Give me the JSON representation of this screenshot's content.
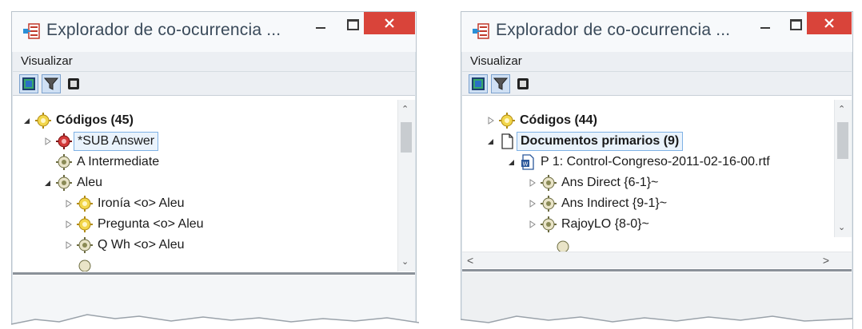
{
  "windows": [
    {
      "title": "Explorador de co-ocurrencia ...",
      "menu": [
        "Visualizar"
      ],
      "tree": [
        {
          "label": "Códigos (45)",
          "bold": true,
          "expander": "expanded",
          "icon": "code-family-icon",
          "indent": 0
        },
        {
          "label": "*SUB Answer",
          "selected": true,
          "expander": "collapsed",
          "icon": "code-red-icon",
          "indent": 1
        },
        {
          "label": "A Intermediate",
          "expander": "none",
          "icon": "code-network-icon",
          "indent": 1
        },
        {
          "label": "Aleu",
          "expander": "expanded",
          "icon": "code-network-icon",
          "indent": 1
        },
        {
          "label": "Ironía <o> Aleu",
          "expander": "collapsed",
          "icon": "code-yellow-icon",
          "indent": 2
        },
        {
          "label": "Pregunta <o> Aleu",
          "expander": "collapsed",
          "icon": "code-yellow-icon",
          "indent": 2
        },
        {
          "label": "Q Wh <o> Aleu",
          "expander": "collapsed",
          "icon": "code-network-icon",
          "indent": 2
        }
      ]
    },
    {
      "title": "Explorador de co-ocurrencia ...",
      "menu": [
        "Visualizar"
      ],
      "tree": [
        {
          "label": "Códigos (44)",
          "bold": true,
          "expander": "collapsed",
          "icon": "code-family-icon",
          "indent": 0
        },
        {
          "label": "Documentos primarios (9)",
          "bold": true,
          "selected": true,
          "expander": "expanded",
          "icon": "document-icon",
          "indent": 0
        },
        {
          "label": "P 1: Control-Congreso-2011-02-16-00.rtf",
          "expander": "expanded",
          "icon": "word-document-icon",
          "indent": 1
        },
        {
          "label": "Ans Direct {6-1}~",
          "expander": "collapsed",
          "icon": "code-network-icon",
          "indent": 2
        },
        {
          "label": "Ans Indirect {9-1}~",
          "expander": "collapsed",
          "icon": "code-network-icon",
          "indent": 2
        },
        {
          "label": "RajoyLO {8-0}~",
          "expander": "collapsed",
          "icon": "code-network-icon",
          "indent": 2
        }
      ]
    }
  ],
  "colors": {
    "close_button": "#d9443a",
    "selection_border": "#7fb2e5",
    "title_text": "#3a4a5a"
  }
}
